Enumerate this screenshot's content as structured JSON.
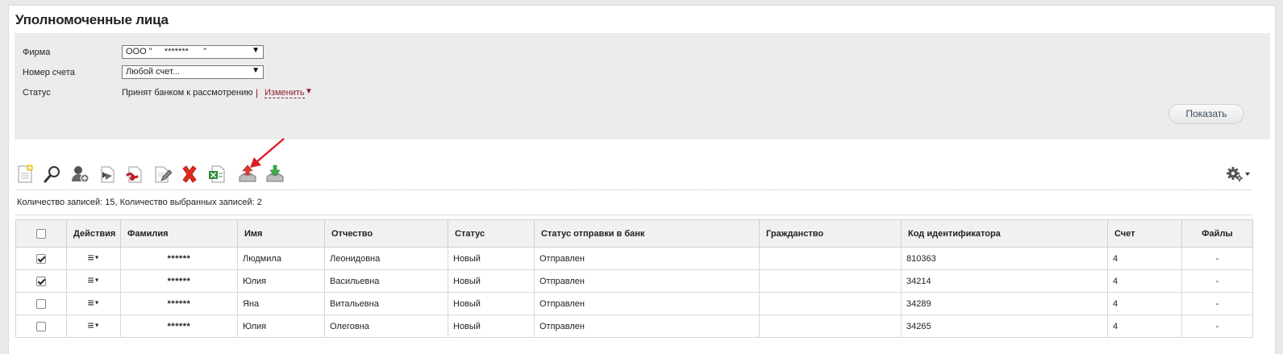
{
  "page": {
    "title": "Уполномоченные лица"
  },
  "filters": {
    "firm": {
      "label": "Фирма",
      "value": "ООО \"     *******      \""
    },
    "account": {
      "label": "Номер счета",
      "value": "Любой счет..."
    },
    "status": {
      "label": "Статус",
      "value": "Принят банком к рассмотрению",
      "separator": "|",
      "change_label": "Изменить"
    },
    "show_button": "Показать"
  },
  "toolbar": {
    "icons": [
      "new-document-icon",
      "search-icon",
      "add-person-icon",
      "sign-icon",
      "remove-signature-icon",
      "edit-icon",
      "delete-icon",
      "excel-export-icon",
      "send-to-bank-icon",
      "import-icon"
    ],
    "settings_icon": "gear-icon",
    "arrow_color": "#e01b22"
  },
  "counts": "Количество записей: 15, Количество выбранных записей: 2",
  "table": {
    "headers": [
      "",
      "Действия",
      "Фамилия",
      "Имя",
      "Отчество",
      "Статус",
      "Статус отправки в банк",
      "Гражданство",
      "Код идентификатора",
      "Счет",
      "Файлы"
    ],
    "rows": [
      {
        "checked": true,
        "surname": "******",
        "name": "Людмила",
        "patronymic": "Леонидовна",
        "status": "Новый",
        "send_status": "Отправлен",
        "citizenship": "",
        "id_code": "810363",
        "account": "4",
        "files": "-"
      },
      {
        "checked": true,
        "surname": "******",
        "name": "Юлия",
        "patronymic": "Васильевна",
        "status": "Новый",
        "send_status": "Отправлен",
        "citizenship": "",
        "id_code": "34214",
        "account": "4",
        "files": "-"
      },
      {
        "checked": false,
        "surname": "******",
        "name": "Яна",
        "patronymic": "Витальевна",
        "status": "Новый",
        "send_status": "Отправлен",
        "citizenship": "",
        "id_code": "34289",
        "account": "4",
        "files": "-"
      },
      {
        "checked": false,
        "surname": "******",
        "name": "Юлия",
        "patronymic": "Олеговна",
        "status": "Новый",
        "send_status": "Отправлен",
        "citizenship": "",
        "id_code": "34265",
        "account": "4",
        "files": "-"
      }
    ]
  }
}
